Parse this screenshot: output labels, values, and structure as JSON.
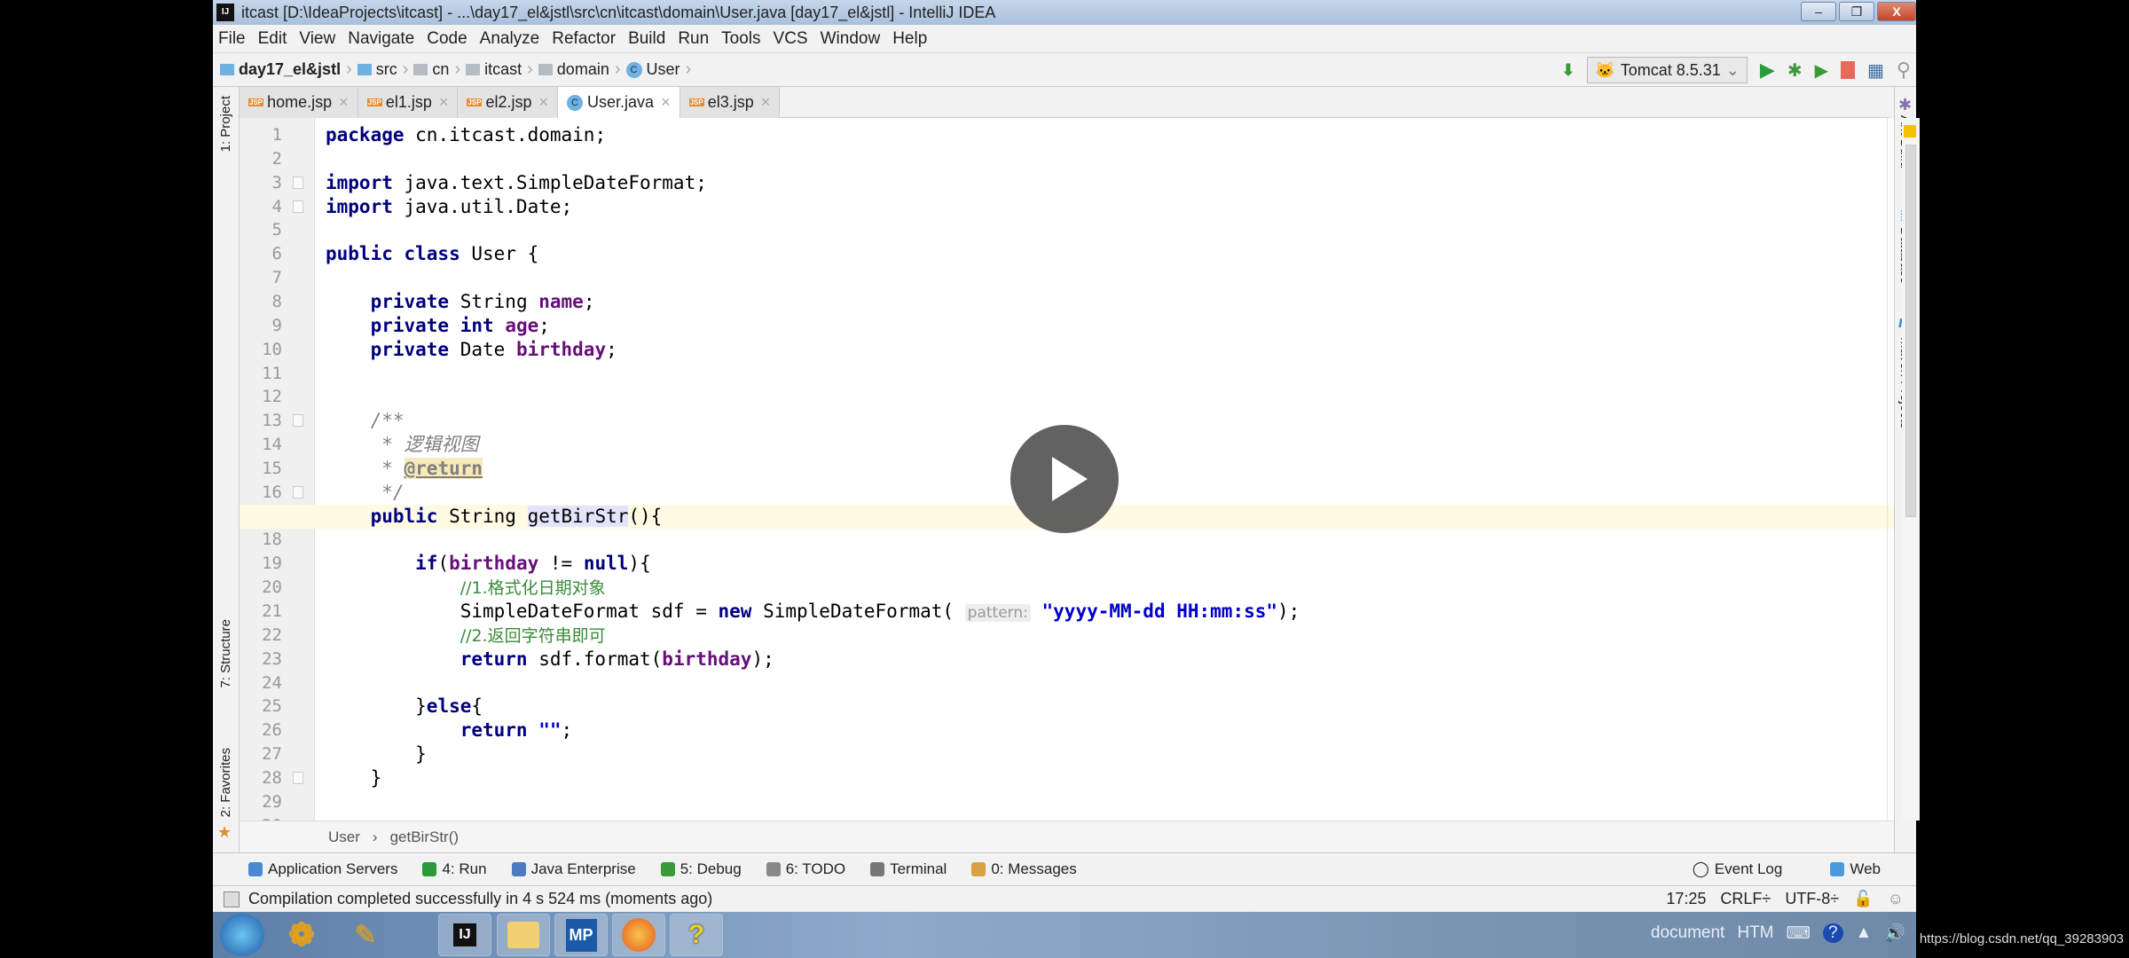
{
  "window": {
    "title": "itcast [D:\\IdeaProjects\\itcast] - ...\\day17_el&jstl\\src\\cn\\itcast\\domain\\User.java [day17_el&jstl] - IntelliJ IDEA",
    "minimize": "–",
    "restore": "❐",
    "close": "X"
  },
  "menu": [
    "File",
    "Edit",
    "View",
    "Navigate",
    "Code",
    "Analyze",
    "Refactor",
    "Build",
    "Run",
    "Tools",
    "VCS",
    "Window",
    "Help"
  ],
  "nav": {
    "crumbs": [
      "day17_el&jstl",
      "src",
      "cn",
      "itcast",
      "domain",
      "User"
    ],
    "run_config": "Tomcat 8.5.31"
  },
  "tabs": [
    {
      "label": "home.jsp",
      "type": "jsp"
    },
    {
      "label": "el1.jsp",
      "type": "jsp"
    },
    {
      "label": "el2.jsp",
      "type": "jsp"
    },
    {
      "label": "User.java",
      "type": "java",
      "active": true
    },
    {
      "label": "el3.jsp",
      "type": "jsp"
    }
  ],
  "left_tools": [
    "1: Project",
    "7: Structure",
    "2: Favorites"
  ],
  "right_tools": [
    "Ant Build",
    "Database",
    "Maven Projects"
  ],
  "editor": {
    "current_line": 17,
    "lines": [
      [
        [
          "kw",
          "package"
        ],
        [
          "p",
          " cn.itcast.domain;"
        ]
      ],
      [],
      [
        [
          "kw",
          "import"
        ],
        [
          "p",
          " java.text.SimpleDateFormat;"
        ]
      ],
      [
        [
          "kw",
          "import"
        ],
        [
          "p",
          " java.util.Date;"
        ]
      ],
      [],
      [
        [
          "kw",
          "public class"
        ],
        [
          "p",
          " User {"
        ]
      ],
      [],
      [
        [
          "p",
          "    "
        ],
        [
          "kw",
          "private"
        ],
        [
          "p",
          " String "
        ],
        [
          "fld",
          "name"
        ],
        [
          "p",
          ";"
        ]
      ],
      [
        [
          "p",
          "    "
        ],
        [
          "kw",
          "private int"
        ],
        [
          "p",
          " "
        ],
        [
          "fld",
          "age"
        ],
        [
          "p",
          ";"
        ]
      ],
      [
        [
          "p",
          "    "
        ],
        [
          "kw",
          "private"
        ],
        [
          "p",
          " Date "
        ],
        [
          "fld",
          "birthday"
        ],
        [
          "p",
          ";"
        ]
      ],
      [],
      [],
      [
        [
          "doc",
          "    /**"
        ]
      ],
      [
        [
          "doc",
          "     * 逻辑视图"
        ]
      ],
      [
        [
          "doc",
          "     * "
        ],
        [
          "tag",
          "@return"
        ]
      ],
      [
        [
          "doc",
          "     */"
        ]
      ],
      [
        [
          "p",
          "    "
        ],
        [
          "kw",
          "public"
        ],
        [
          "p",
          " String "
        ],
        [
          "hl",
          "getBirStr"
        ],
        [
          "p",
          "(){"
        ]
      ],
      [],
      [
        [
          "p",
          "        "
        ],
        [
          "kw",
          "if"
        ],
        [
          "p",
          "("
        ],
        [
          "fld",
          "birthday"
        ],
        [
          "p",
          " != "
        ],
        [
          "kw",
          "null"
        ],
        [
          "p",
          "){"
        ]
      ],
      [
        [
          "p",
          "            "
        ],
        [
          "cmt",
          "//1.格式化日期对象"
        ]
      ],
      [
        [
          "p",
          "            SimpleDateFormat sdf = "
        ],
        [
          "kw",
          "new"
        ],
        [
          "p",
          " SimpleDateFormat( "
        ],
        [
          "hint",
          "pattern:"
        ],
        [
          "str",
          " \"yyyy-MM-dd HH:mm:ss\""
        ],
        [
          "p",
          ");"
        ]
      ],
      [
        [
          "p",
          "            "
        ],
        [
          "cmt",
          "//2.返回字符串即可"
        ]
      ],
      [
        [
          "p",
          "            "
        ],
        [
          "kw",
          "return"
        ],
        [
          "p",
          " sdf.format("
        ],
        [
          "fld",
          "birthday"
        ],
        [
          "p",
          ");"
        ]
      ],
      [],
      [
        [
          "p",
          "        }"
        ],
        [
          "kw",
          "else"
        ],
        [
          "p",
          "{"
        ]
      ],
      [
        [
          "p",
          "            "
        ],
        [
          "kw",
          "return"
        ],
        [
          "str",
          " \"\""
        ],
        [
          "p",
          ";"
        ]
      ],
      [
        [
          "p",
          "        }"
        ]
      ],
      [
        [
          "p",
          "    }"
        ]
      ],
      [],
      []
    ]
  },
  "bottom_crumb": [
    "User",
    "getBirStr()"
  ],
  "toolwindows": [
    "Application Servers",
    "4: Run",
    "Java Enterprise",
    "5: Debug",
    "6: TODO",
    "Terminal",
    "0: Messages"
  ],
  "toolwindows_right": [
    "Event Log",
    "Web"
  ],
  "status": {
    "message": "Compilation completed successfully in 4 s 524 ms (moments ago)",
    "position": "17:25",
    "line_sep": "CRLF÷",
    "encoding": "UTF-8÷"
  },
  "taskbar": {
    "apps": [
      "IJ",
      "MP",
      "?"
    ],
    "tray_text": "document",
    "tray_htm": "HTM"
  },
  "watermark": "https://blog.csdn.net/qq_39283903",
  "colors": {
    "keyword": "#000080",
    "field": "#660e7a",
    "comment": "#3a8c3a",
    "string": "#0000cc",
    "current_line": "#fffae3"
  }
}
